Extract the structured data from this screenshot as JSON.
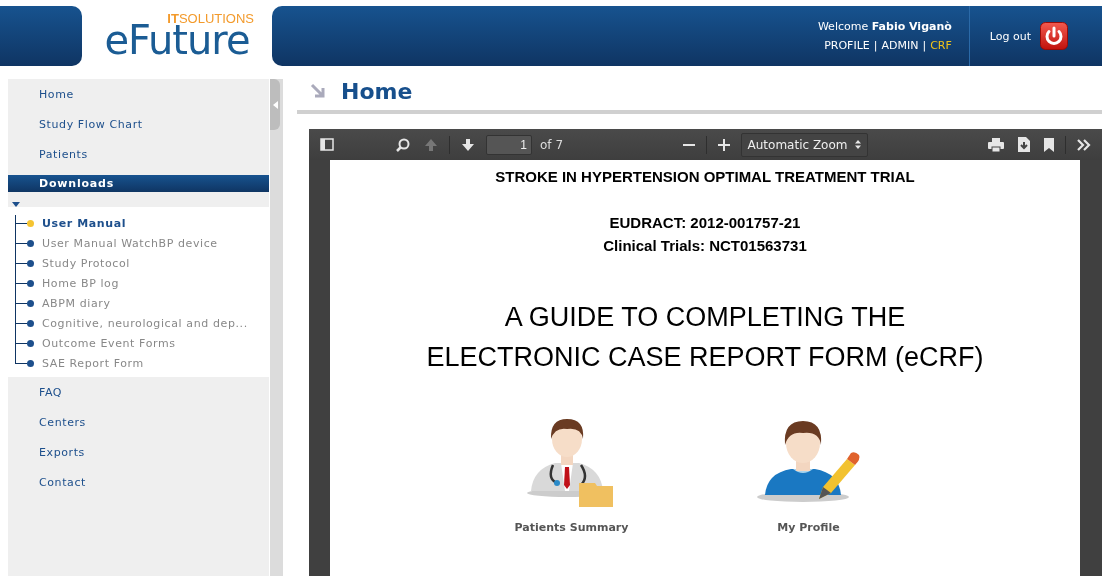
{
  "header": {
    "logo": {
      "brand": "eFuture",
      "tagline": "**IT**SOLUTIONS"
    },
    "welcome": "Welcome **Fabio Viganò**",
    "links": [
      {
        "label": "PROFILE",
        "selected": false
      },
      {
        "label": "ADMIN",
        "selected": false
      },
      {
        "label": "CRF",
        "selected": true
      }
    ],
    "separator": "|",
    "logout": "Log out"
  },
  "sidebar": {
    "items": [
      {
        "label": "Home",
        "kind": "link"
      },
      {
        "label": "Study Flow Chart",
        "kind": "link"
      },
      {
        "label": "Patients",
        "kind": "link"
      },
      {
        "label": "Downloads",
        "kind": "section",
        "expanded": true,
        "children": [
          {
            "label": "User Manual",
            "selected": true
          },
          {
            "label": "User Manual WatchBP device",
            "selected": false
          },
          {
            "label": "Study Protocol",
            "selected": false
          },
          {
            "label": "Home BP log",
            "selected": false
          },
          {
            "label": "ABPM diary",
            "selected": false
          },
          {
            "label": "Cognitive, neurological and dep...",
            "selected": false
          },
          {
            "label": "Outcome Event Forms",
            "selected": false
          },
          {
            "label": "SAE Report Form",
            "selected": false
          }
        ]
      },
      {
        "label": "FAQ",
        "kind": "link"
      },
      {
        "label": "Centers",
        "kind": "link"
      },
      {
        "label": "Exports",
        "kind": "link"
      },
      {
        "label": "Contact",
        "kind": "link"
      }
    ]
  },
  "page_title": "Home",
  "pdf_viewer": {
    "toolbar": {
      "page_number": "1",
      "page_count": "of 7",
      "zoom": "Automatic Zoom"
    },
    "document": {
      "lines": [
        {
          "text": "STROKE IN HYPERTENSION OPTIMAL TREATMENT TRIAL",
          "kind": "heading"
        },
        {
          "text": "EUDRACT: 2012-001757-21",
          "kind": "id"
        },
        {
          "text": "Clinical Trials: NCT01563731",
          "kind": "id"
        },
        {
          "text": "A GUIDE TO COMPLETING THE",
          "kind": "title"
        },
        {
          "text": "ELECTRONIC CASE REPORT FORM (eCRF)",
          "kind": "title"
        }
      ],
      "figures": [
        {
          "kind": "doctor",
          "caption": "Patients Summary"
        },
        {
          "kind": "user",
          "caption": "My Profile"
        }
      ]
    }
  }
}
